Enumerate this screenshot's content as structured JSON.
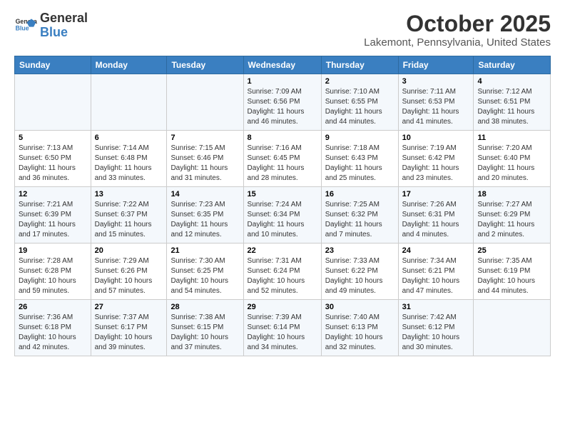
{
  "header": {
    "logo_line1": "General",
    "logo_line2": "Blue",
    "month_title": "October 2025",
    "location": "Lakemont, Pennsylvania, United States"
  },
  "days_of_week": [
    "Sunday",
    "Monday",
    "Tuesday",
    "Wednesday",
    "Thursday",
    "Friday",
    "Saturday"
  ],
  "weeks": [
    [
      {
        "num": "",
        "info": ""
      },
      {
        "num": "",
        "info": ""
      },
      {
        "num": "",
        "info": ""
      },
      {
        "num": "1",
        "info": "Sunrise: 7:09 AM\nSunset: 6:56 PM\nDaylight: 11 hours and 46 minutes."
      },
      {
        "num": "2",
        "info": "Sunrise: 7:10 AM\nSunset: 6:55 PM\nDaylight: 11 hours and 44 minutes."
      },
      {
        "num": "3",
        "info": "Sunrise: 7:11 AM\nSunset: 6:53 PM\nDaylight: 11 hours and 41 minutes."
      },
      {
        "num": "4",
        "info": "Sunrise: 7:12 AM\nSunset: 6:51 PM\nDaylight: 11 hours and 38 minutes."
      }
    ],
    [
      {
        "num": "5",
        "info": "Sunrise: 7:13 AM\nSunset: 6:50 PM\nDaylight: 11 hours and 36 minutes."
      },
      {
        "num": "6",
        "info": "Sunrise: 7:14 AM\nSunset: 6:48 PM\nDaylight: 11 hours and 33 minutes."
      },
      {
        "num": "7",
        "info": "Sunrise: 7:15 AM\nSunset: 6:46 PM\nDaylight: 11 hours and 31 minutes."
      },
      {
        "num": "8",
        "info": "Sunrise: 7:16 AM\nSunset: 6:45 PM\nDaylight: 11 hours and 28 minutes."
      },
      {
        "num": "9",
        "info": "Sunrise: 7:18 AM\nSunset: 6:43 PM\nDaylight: 11 hours and 25 minutes."
      },
      {
        "num": "10",
        "info": "Sunrise: 7:19 AM\nSunset: 6:42 PM\nDaylight: 11 hours and 23 minutes."
      },
      {
        "num": "11",
        "info": "Sunrise: 7:20 AM\nSunset: 6:40 PM\nDaylight: 11 hours and 20 minutes."
      }
    ],
    [
      {
        "num": "12",
        "info": "Sunrise: 7:21 AM\nSunset: 6:39 PM\nDaylight: 11 hours and 17 minutes."
      },
      {
        "num": "13",
        "info": "Sunrise: 7:22 AM\nSunset: 6:37 PM\nDaylight: 11 hours and 15 minutes."
      },
      {
        "num": "14",
        "info": "Sunrise: 7:23 AM\nSunset: 6:35 PM\nDaylight: 11 hours and 12 minutes."
      },
      {
        "num": "15",
        "info": "Sunrise: 7:24 AM\nSunset: 6:34 PM\nDaylight: 11 hours and 10 minutes."
      },
      {
        "num": "16",
        "info": "Sunrise: 7:25 AM\nSunset: 6:32 PM\nDaylight: 11 hours and 7 minutes."
      },
      {
        "num": "17",
        "info": "Sunrise: 7:26 AM\nSunset: 6:31 PM\nDaylight: 11 hours and 4 minutes."
      },
      {
        "num": "18",
        "info": "Sunrise: 7:27 AM\nSunset: 6:29 PM\nDaylight: 11 hours and 2 minutes."
      }
    ],
    [
      {
        "num": "19",
        "info": "Sunrise: 7:28 AM\nSunset: 6:28 PM\nDaylight: 10 hours and 59 minutes."
      },
      {
        "num": "20",
        "info": "Sunrise: 7:29 AM\nSunset: 6:26 PM\nDaylight: 10 hours and 57 minutes."
      },
      {
        "num": "21",
        "info": "Sunrise: 7:30 AM\nSunset: 6:25 PM\nDaylight: 10 hours and 54 minutes."
      },
      {
        "num": "22",
        "info": "Sunrise: 7:31 AM\nSunset: 6:24 PM\nDaylight: 10 hours and 52 minutes."
      },
      {
        "num": "23",
        "info": "Sunrise: 7:33 AM\nSunset: 6:22 PM\nDaylight: 10 hours and 49 minutes."
      },
      {
        "num": "24",
        "info": "Sunrise: 7:34 AM\nSunset: 6:21 PM\nDaylight: 10 hours and 47 minutes."
      },
      {
        "num": "25",
        "info": "Sunrise: 7:35 AM\nSunset: 6:19 PM\nDaylight: 10 hours and 44 minutes."
      }
    ],
    [
      {
        "num": "26",
        "info": "Sunrise: 7:36 AM\nSunset: 6:18 PM\nDaylight: 10 hours and 42 minutes."
      },
      {
        "num": "27",
        "info": "Sunrise: 7:37 AM\nSunset: 6:17 PM\nDaylight: 10 hours and 39 minutes."
      },
      {
        "num": "28",
        "info": "Sunrise: 7:38 AM\nSunset: 6:15 PM\nDaylight: 10 hours and 37 minutes."
      },
      {
        "num": "29",
        "info": "Sunrise: 7:39 AM\nSunset: 6:14 PM\nDaylight: 10 hours and 34 minutes."
      },
      {
        "num": "30",
        "info": "Sunrise: 7:40 AM\nSunset: 6:13 PM\nDaylight: 10 hours and 32 minutes."
      },
      {
        "num": "31",
        "info": "Sunrise: 7:42 AM\nSunset: 6:12 PM\nDaylight: 10 hours and 30 minutes."
      },
      {
        "num": "",
        "info": ""
      }
    ]
  ]
}
